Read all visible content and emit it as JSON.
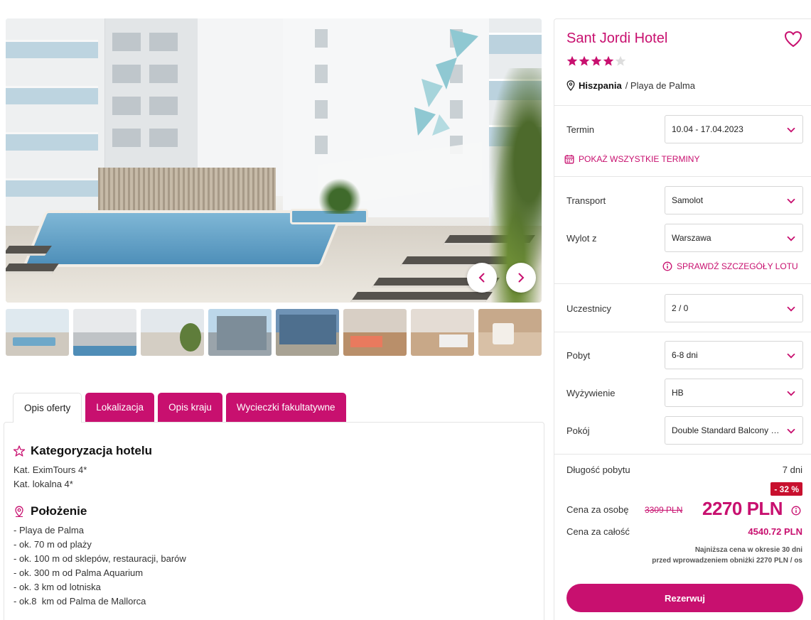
{
  "colors": {
    "accent": "#c8106f",
    "discount": "#c8102e",
    "star": "#c8106f",
    "star_empty": "#dddddd"
  },
  "gallery": {
    "prev_icon": "chevron-left-icon",
    "next_icon": "chevron-right-icon",
    "thumbnails": [
      "pool-view",
      "hotel-facade-pool",
      "pool-terrace",
      "hotel-exterior",
      "hotel-street-view",
      "room-balcony",
      "twin-room",
      "bathroom"
    ]
  },
  "tabs": {
    "active": "Opis oferty",
    "items": [
      "Lokalizacja",
      "Opis kraju",
      "Wycieczki fakultatywne"
    ]
  },
  "description": {
    "categorization_title": "Kategoryzacja hotelu",
    "categorization_lines": [
      "Kat. EximTours 4*",
      "Kat. lokalna 4*"
    ],
    "location_title": "Położenie",
    "location_lines": [
      "- Playa de Palma",
      "- ok. 70 m od plaży",
      "- ok. 100 m od sklepów, restauracji, barów",
      "- ok. 300 m od Palma Aquarium",
      "- ok. 3 km od lotniska",
      "- ok.8  km od Palma de Mallorca"
    ]
  },
  "hotel": {
    "name": "Sant Jordi Hotel",
    "stars": 4,
    "stars_max": 5,
    "country": "Hiszpania",
    "region": "/ Playa de Palma"
  },
  "booking": {
    "term_label": "Termin",
    "term_value": "10.04 - 17.04.2023",
    "all_terms_link": "POKAŻ WSZYSTKIE TERMINY",
    "transport_label": "Transport",
    "transport_value": "Samolot",
    "departure_label": "Wylot z",
    "departure_value": "Warszawa",
    "flight_details_link": "SPRAWDŹ SZCZEGÓŁY LOTU",
    "participants_label": "Uczestnicy",
    "participants_value": "2 / 0",
    "stay_label": "Pobyt",
    "stay_value": "6-8 dni",
    "board_label": "Wyżywienie",
    "board_value": "HB",
    "room_label": "Pokój",
    "room_value": "Double Standard Balcony or Terrace"
  },
  "price": {
    "length_label": "Długość pobytu",
    "length_value": "7 dni",
    "discount": "- 32 %",
    "per_person_label": "Cena za osobę",
    "old_price": "3309 PLN",
    "new_price": "2270 PLN",
    "total_label": "Cena za całość",
    "total_value": "4540.72 PLN",
    "lowest_note_1": "Najniższa cena w okresie 30 dni",
    "lowest_note_2": "przed wprowadzeniem obniżki 2270 PLN / os",
    "reserve_label": "Rezerwuj"
  }
}
